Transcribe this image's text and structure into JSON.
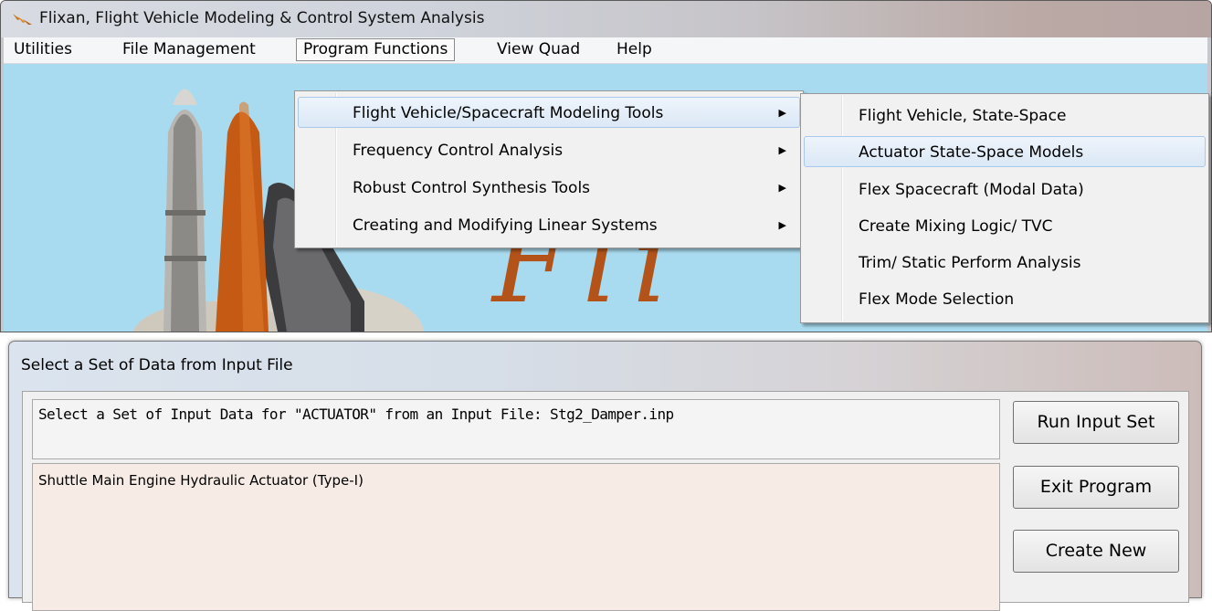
{
  "window": {
    "title": "Flixan, Flight Vehicle Modeling & Control System Analysis",
    "icon": "flixan-app-icon"
  },
  "menubar": {
    "items": [
      "Utilities",
      "File Management",
      "Program Functions",
      "View Quad",
      "Help"
    ],
    "open_item": "Program Functions"
  },
  "background": {
    "logo_text": "Fli",
    "color_sky": "#a9dbf0",
    "color_logo": "#b3531a"
  },
  "program_functions_menu": {
    "items": [
      "Flight Vehicle/Spacecraft Modeling Tools",
      "Frequency Control Analysis",
      "Robust Control Synthesis Tools",
      "Creating and Modifying Linear Systems"
    ],
    "highlighted": "Flight Vehicle/Spacecraft Modeling Tools"
  },
  "modeling_tools_submenu": {
    "items": [
      "Flight Vehicle, State-Space",
      "Actuator State-Space Models",
      "Flex Spacecraft (Modal Data)",
      "Create Mixing Logic/ TVC",
      "Trim/ Static Perform Analysis",
      "Flex Mode Selection"
    ],
    "highlighted": "Actuator State-Space Models"
  },
  "dialog": {
    "title": "Select a Set of Data from Input File",
    "header_text": "Select a Set of Input Data for \"ACTUATOR\" from an Input File: Stg2_Damper.inp",
    "list_items": [
      "Shuttle Main Engine Hydraulic Actuator (Type-I)"
    ],
    "buttons": {
      "run": "Run Input Set",
      "exit": "Exit Program",
      "create": "Create New"
    }
  }
}
